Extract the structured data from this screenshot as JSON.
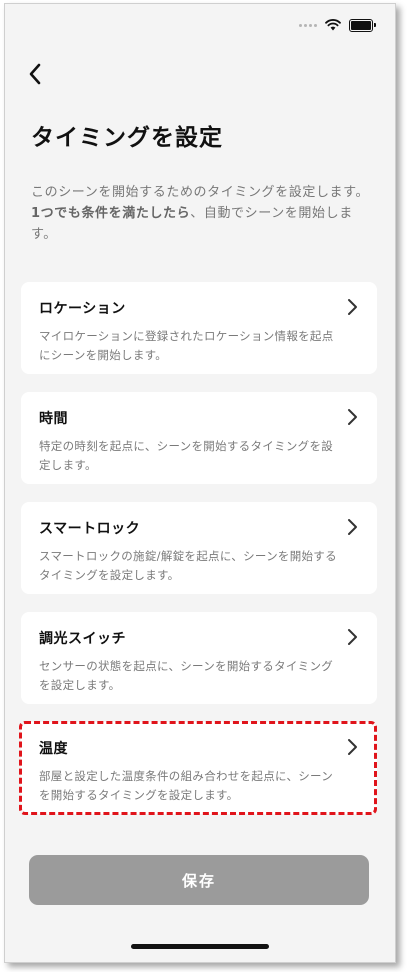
{
  "header": {
    "title": "タイミングを設定"
  },
  "description": {
    "text_part1": "このシーンを開始するためのタイミングを設定します。",
    "bold_part": "1つでも条件を満たしたら",
    "text_part2": "、自動でシーンを開始します。"
  },
  "cards": [
    {
      "title": "ロケーション",
      "description": "マイロケーションに登録されたロケーション情報を起点にシーンを開始します。"
    },
    {
      "title": "時間",
      "description": "特定の時刻を起点に、シーンを開始するタイミングを設定します。"
    },
    {
      "title": "スマートロック",
      "description": "スマートロックの施錠/解錠を起点に、シーンを開始するタイミングを設定します。"
    },
    {
      "title": "調光スイッチ",
      "description": "センサーの状態を起点に、シーンを開始するタイミングを設定します。"
    },
    {
      "title": "温度",
      "description": "部屋と設定した温度条件の組み合わせを起点に、シーンを開始するタイミングを設定します。"
    }
  ],
  "footer": {
    "save_label": "保存"
  },
  "icons": {
    "back": "chevron-left-icon",
    "card": "chevron-right-icon",
    "wifi": "wifi-icon",
    "battery": "battery-icon"
  },
  "colors": {
    "background": "#f4f4f4",
    "card": "#ffffff",
    "highlight": "#e0141b",
    "save_button": "#9b9b9b"
  }
}
